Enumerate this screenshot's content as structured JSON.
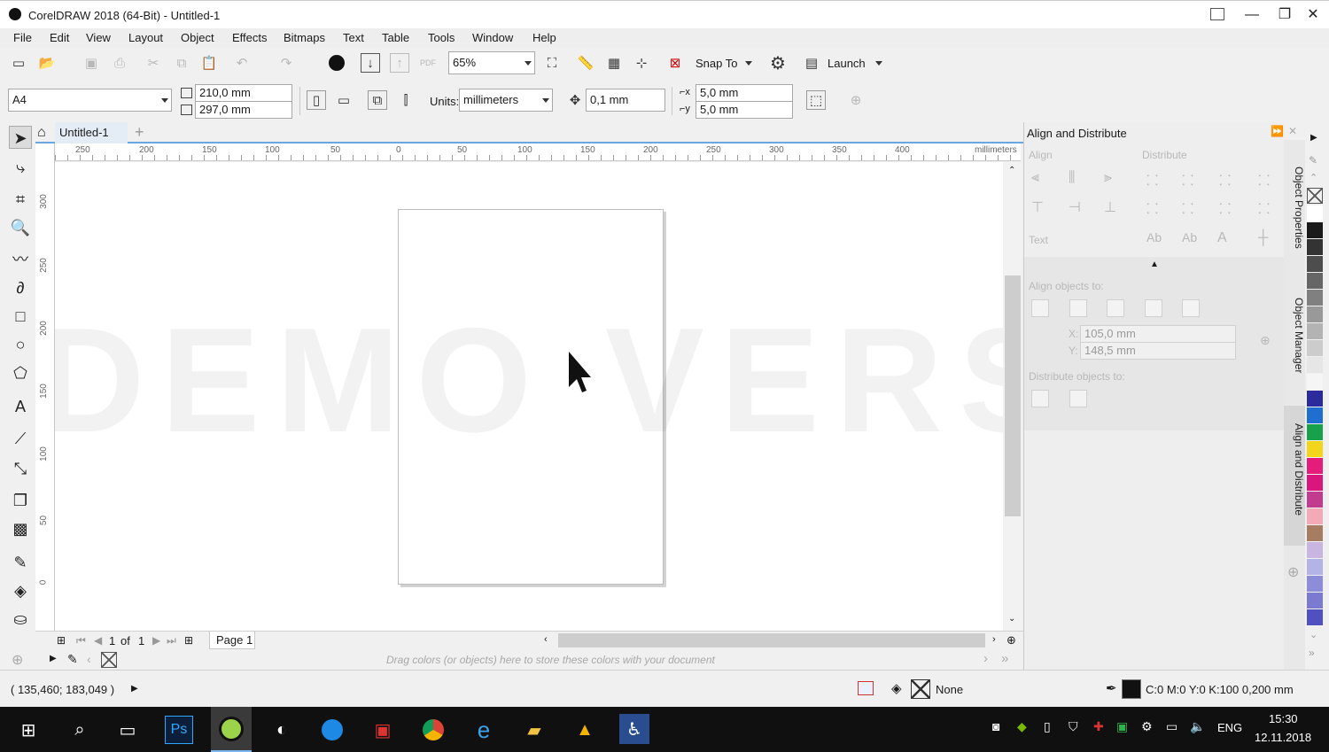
{
  "window": {
    "title": "CorelDRAW 2018 (64-Bit) - Untitled-1",
    "minimize": "—",
    "maximize": "❐",
    "close": "✕"
  },
  "menu": [
    "File",
    "Edit",
    "View",
    "Layout",
    "Object",
    "Effects",
    "Bitmaps",
    "Text",
    "Table",
    "Tools",
    "Window",
    "Help"
  ],
  "standard_toolbar": {
    "zoom_value": "65%",
    "snap_to_label": "Snap To",
    "launch_label": "Launch",
    "pdf_label": "PDF"
  },
  "property_bar": {
    "page_size": "A4",
    "width": "210,0 mm",
    "height": "297,0 mm",
    "units_label": "Units:",
    "units_value": "millimeters",
    "nudge": "0,1 mm",
    "dup_x": "5,0 mm",
    "dup_y": "5,0 mm"
  },
  "document_tab": {
    "label": "Untitled-1",
    "add": "+"
  },
  "ruler": {
    "h_ticks": [
      "250",
      "200",
      "150",
      "100",
      "50",
      "0",
      "50",
      "100",
      "150",
      "200",
      "250",
      "300",
      "350",
      "400"
    ],
    "h_unit": "millimeters",
    "v_ticks": [
      "300",
      "250",
      "200",
      "150",
      "100",
      "50",
      "0"
    ]
  },
  "canvas": {
    "watermark": "DEMO VERSION"
  },
  "page_nav": {
    "current": "1",
    "of_label": "of",
    "total": "1",
    "page_tab": "Page 1"
  },
  "document_palette": {
    "hint": "Drag colors (or objects) here to store these colors with your document"
  },
  "docker": {
    "title": "Align and Distribute",
    "align_label": "Align",
    "distribute_label": "Distribute",
    "text_label": "Text",
    "align_objects_to": "Align objects to:",
    "x_label": "X:",
    "x_value": "105,0 mm",
    "y_label": "Y:",
    "y_value": "148,5 mm",
    "distribute_objects_to": "Distribute objects to:"
  },
  "vertical_tabs": [
    "Object Properties",
    "Object Manager",
    "Align and Distribute"
  ],
  "palette_colors": [
    "#ffffff",
    "#1a1a1a",
    "#333333",
    "#4d4d4d",
    "#666666",
    "#808080",
    "#999999",
    "#b3b3b3",
    "#cccccc",
    "#e6e6e6",
    "#f5f5f5",
    "#2b2b9e",
    "#1f6fd1",
    "#19a04b",
    "#f3d51b",
    "#e51c7a",
    "#d8167e",
    "#c13b8e",
    "#f4a9b6",
    "#a67c63",
    "#c8b5e0",
    "#b3b3e6",
    "#8c8cd9",
    "#7a7ad1",
    "#5050c0"
  ],
  "status": {
    "coords": "( 135,460; 183,049 )",
    "fill_label": "None",
    "outline_info": "C:0 M:0 Y:0 K:100  0,200 mm"
  },
  "taskbar": {
    "lang": "ENG",
    "time": "15:30",
    "date": "12.11.2018",
    "ps_label": "Ps"
  }
}
